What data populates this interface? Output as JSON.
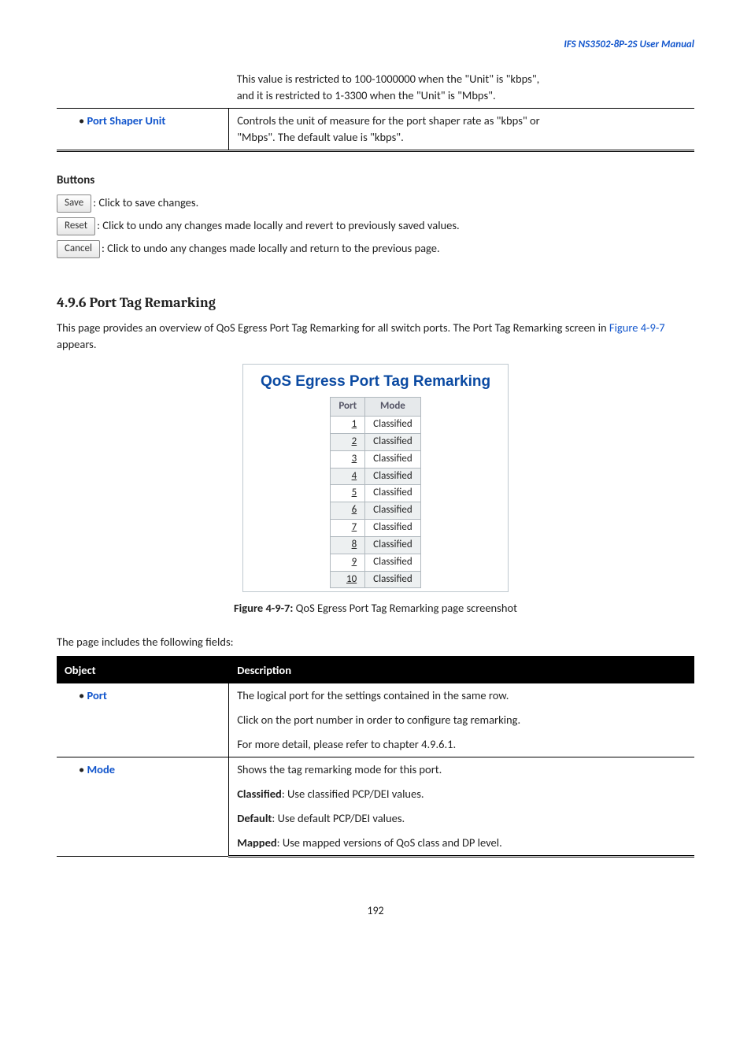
{
  "header": {
    "title": "IFS  NS3502-8P-2S  User  Manual"
  },
  "top_table": {
    "row1_desc_line1": "This value is restricted to 100-1000000 when the \"Unit\" is \"kbps\",",
    "row1_desc_line2": "and it is restricted to 1-3300 when the \"Unit\" is \"Mbps\".",
    "row2_label": "Port Shaper Unit",
    "row2_desc_line1": "Controls the unit of measure for the port shaper rate as \"kbps\" or",
    "row2_desc_line2": "\"Mbps\". The default value is \"kbps\"."
  },
  "buttons_section": {
    "heading": "Buttons",
    "save_label": "Save",
    "save_text": ": Click to save changes.",
    "reset_label": "Reset",
    "reset_text": ": Click to undo any changes made locally and revert to previously saved values.",
    "cancel_label": "Cancel",
    "cancel_text": ": Click to undo any changes made locally and return to the previous page."
  },
  "section": {
    "number_title": "4.9.6 Port Tag Remarking",
    "para_part1": "This page provides an overview of QoS Egress Port Tag Remarking for all switch ports. The Port Tag Remarking screen in ",
    "para_link": "Figure 4-9-7",
    "para_part2": " appears."
  },
  "qos_fig": {
    "title": "QoS Egress Port Tag Remarking",
    "col_port": "Port",
    "col_mode": "Mode",
    "rows": [
      {
        "port": "1",
        "mode": "Classified"
      },
      {
        "port": "2",
        "mode": "Classified"
      },
      {
        "port": "3",
        "mode": "Classified"
      },
      {
        "port": "4",
        "mode": "Classified"
      },
      {
        "port": "5",
        "mode": "Classified"
      },
      {
        "port": "6",
        "mode": "Classified"
      },
      {
        "port": "7",
        "mode": "Classified"
      },
      {
        "port": "8",
        "mode": "Classified"
      },
      {
        "port": "9",
        "mode": "Classified"
      },
      {
        "port": "10",
        "mode": "Classified"
      }
    ]
  },
  "fig_caption": {
    "lead": "Figure 4-9-7:",
    "rest": " QoS Egress Port Tag Remarking page screenshot"
  },
  "fields_intro": "The page includes the following fields:",
  "fields_table": {
    "head_obj": "Object",
    "head_desc": "Description",
    "port_label": "Port",
    "port_desc1": "The logical port for the settings contained in the same row.",
    "port_desc2": "Click on the port number in order to configure tag remarking.",
    "port_desc3": "For more detail, please refer to chapter 4.9.6.1.",
    "mode_label": "Mode",
    "mode_desc1": "Shows the tag remarking mode for this port.",
    "mode_desc2_strong": "Classified",
    "mode_desc2_rest": ": Use classified PCP/DEI values.",
    "mode_desc3_strong": "Default",
    "mode_desc3_rest": ": Use default PCP/DEI values.",
    "mode_desc4_strong": "Mapped",
    "mode_desc4_rest": ": Use mapped versions of QoS class and DP level."
  },
  "footer": {
    "page": "192"
  }
}
